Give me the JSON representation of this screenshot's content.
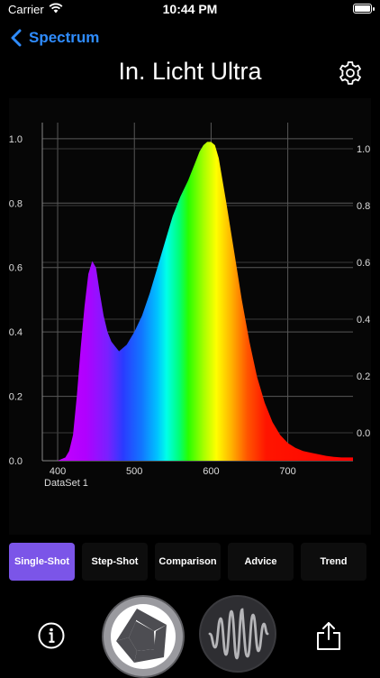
{
  "status_bar": {
    "carrier": "Carrier",
    "time": "10:44 PM"
  },
  "nav": {
    "back_label": "Spectrum",
    "title": "In. Licht Ultra"
  },
  "chart_data": {
    "type": "area",
    "dataset_label": "DataSet 1",
    "x_ticks": [
      "400",
      "500",
      "600",
      "700"
    ],
    "y_left_ticks": [
      "0.0",
      "0.2",
      "0.4",
      "0.6",
      "0.8",
      "1.0"
    ],
    "y_right_ticks": [
      "0.0",
      "0.2",
      "0.4",
      "0.6",
      "0.8",
      "1.0"
    ],
    "xlim": [
      380,
      785
    ],
    "ylim": [
      0,
      1.05
    ],
    "grid": true,
    "x": [
      380,
      390,
      400,
      410,
      415,
      420,
      425,
      430,
      435,
      440,
      445,
      450,
      455,
      460,
      465,
      470,
      475,
      480,
      485,
      490,
      500,
      510,
      520,
      530,
      540,
      550,
      560,
      570,
      580,
      585,
      590,
      595,
      600,
      605,
      610,
      620,
      630,
      640,
      650,
      660,
      670,
      680,
      690,
      700,
      710,
      720,
      730,
      740,
      750,
      760,
      770,
      780,
      785
    ],
    "y": [
      0.0,
      0.0,
      0.0,
      0.01,
      0.03,
      0.08,
      0.2,
      0.35,
      0.48,
      0.58,
      0.62,
      0.6,
      0.52,
      0.45,
      0.4,
      0.37,
      0.355,
      0.34,
      0.35,
      0.36,
      0.4,
      0.45,
      0.52,
      0.6,
      0.68,
      0.76,
      0.82,
      0.87,
      0.93,
      0.96,
      0.98,
      0.99,
      0.99,
      0.98,
      0.94,
      0.8,
      0.65,
      0.5,
      0.37,
      0.26,
      0.18,
      0.12,
      0.08,
      0.055,
      0.04,
      0.03,
      0.025,
      0.02,
      0.015,
      0.012,
      0.01,
      0.01,
      0.01
    ]
  },
  "tabs": [
    {
      "label": "Single-Shot",
      "active": true
    },
    {
      "label": "Step-Shot",
      "active": false
    },
    {
      "label": "Comparison",
      "active": false
    },
    {
      "label": "Advice",
      "active": false
    },
    {
      "label": "Trend",
      "active": false
    }
  ],
  "toolbar": {
    "info_icon": "info-icon",
    "shutter_icon": "aperture-icon",
    "waveform_icon": "waveform-icon",
    "share_icon": "share-icon"
  },
  "colors": {
    "accent": "#2f8cff",
    "active_tab": "#7b55e8"
  }
}
